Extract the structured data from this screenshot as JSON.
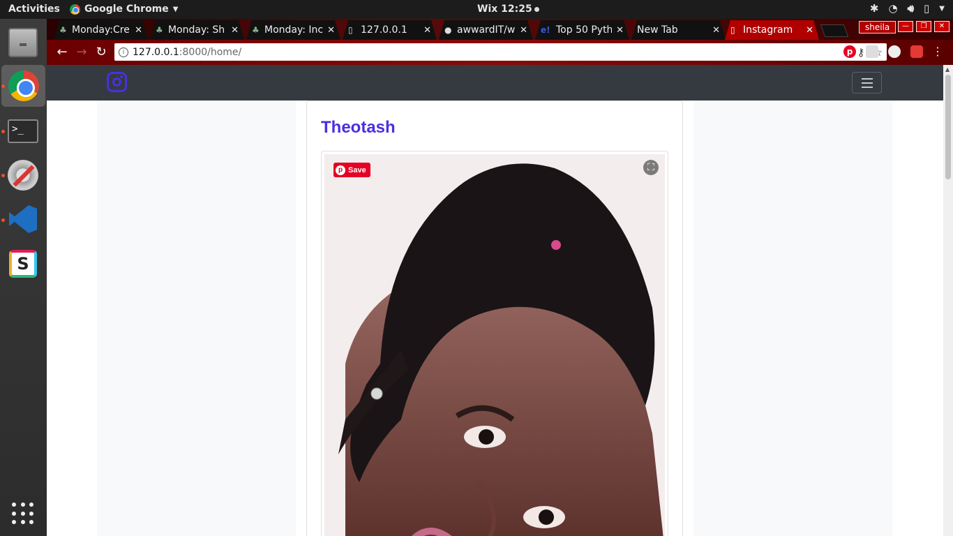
{
  "topbar": {
    "activities": "Activities",
    "app_name": "Google Chrome",
    "clock": "Wix 12:25"
  },
  "browser": {
    "tabs": [
      {
        "title": "Monday:Cre",
        "icon": "tree-icon"
      },
      {
        "title": "Monday: Sh",
        "icon": "tree-icon"
      },
      {
        "title": "Monday: Inc",
        "icon": "tree-icon"
      },
      {
        "title": "127.0.0.1",
        "icon": "page-icon"
      },
      {
        "title": "awwardIT/w",
        "icon": "github-icon"
      },
      {
        "title": "Top 50 Pyth",
        "icon": "e-icon"
      },
      {
        "title": "New Tab",
        "icon": ""
      },
      {
        "title": "Instagram",
        "icon": "page-icon",
        "active": true
      }
    ],
    "profile_name": "sheila",
    "url_host": "127.0.0.1",
    "url_rest": ":8000/home/"
  },
  "page": {
    "post_username": "Theotash",
    "save_label": "Save",
    "accent_color": "#4a2fe0"
  }
}
